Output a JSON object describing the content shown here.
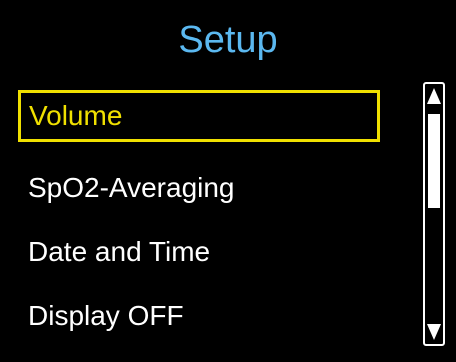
{
  "screen": {
    "title": "Setup",
    "colors": {
      "background": "#000000",
      "title": "#5bb8f0",
      "item_text": "#ffffff",
      "selected": "#f0e000"
    }
  },
  "menu": {
    "items": [
      {
        "label": "Volume",
        "selected": true
      },
      {
        "label": "SpO2-Averaging",
        "selected": false
      },
      {
        "label": "Date and Time",
        "selected": false
      },
      {
        "label": "Display OFF",
        "selected": false
      }
    ]
  },
  "scrollbar": {
    "up_icon": "triangle-up-icon",
    "down_icon": "triangle-down-icon",
    "position_fraction": 0.0,
    "visible_fraction": 0.4
  }
}
